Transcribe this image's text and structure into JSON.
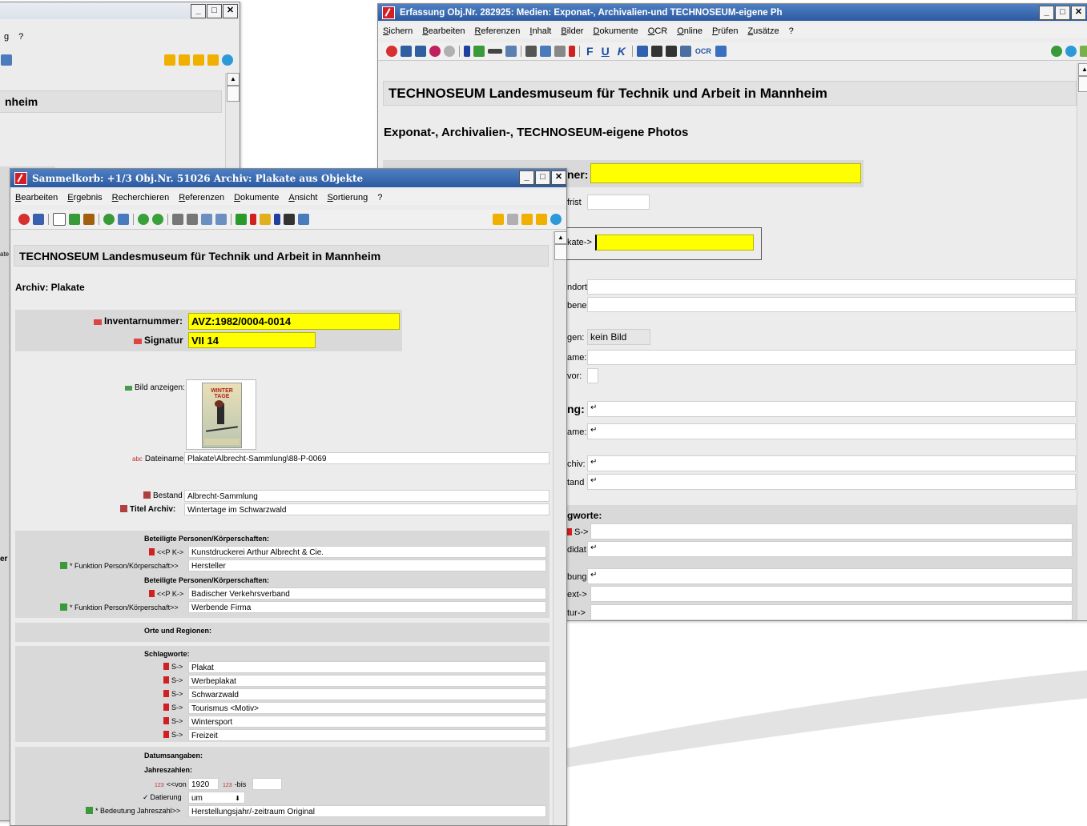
{
  "win_left": {
    "menu": [
      "g",
      "?"
    ],
    "title_frag": "nheim"
  },
  "win_right": {
    "title": "Erfassung Obj.Nr. 282925: Medien: Exponat-, Archivalien-und TECHNOSEUM-eigene Ph",
    "menu": [
      "Sichern",
      "Bearbeiten",
      "Referenzen",
      "Inhalt",
      "Bilder",
      "Dokumente",
      "OCR",
      "Online",
      "Prüfen",
      "Zusätze",
      "?"
    ],
    "toolbar_text": [
      "F",
      "U",
      "K",
      "OCR"
    ],
    "heading": "TECHNOSEUM Landesmuseum für Technik und Arbeit in Mannheim",
    "subheading": "Exponat-, Archivalien-, TECHNOSEUM-eigene Photos",
    "labels": {
      "ner": "ner:",
      "frist": "frist",
      "kate": "kate->",
      "ndort": "ndort",
      "bene": "bene",
      "gen": "gen:",
      "ame": "ame:",
      "vor": "vor:",
      "ng": "ng:",
      "ame2": "ame:",
      "chiv": "chiv:",
      "tand": "tand",
      "gworte": "gworte:",
      "s": "S->",
      "didat": "didat:",
      "bung": "bung:",
      "ext": "ext->",
      "tur": "tur->"
    },
    "bild_value": "kein Bild",
    "return_mark": "↵"
  },
  "win_front": {
    "title": "Sammelkorb: +1/3  Obj.Nr. 51026  Archiv: Plakate aus Objekte",
    "menu": [
      "Bearbeiten",
      "Ergebnis",
      "Recherchieren",
      "Referenzen",
      "Dokumente",
      "Ansicht",
      "Sortierung",
      "?"
    ],
    "heading": "TECHNOSEUM Landesmuseum für Technik und Arbeit in Mannheim",
    "subheading": "Archiv: Plakate",
    "inventar_label": "Inventarnummer:",
    "inventar_value": "AVZ:1982/0004-0014",
    "signatur_label": "Signatur",
    "signatur_value": "VII 14",
    "bild_label": "Bild anzeigen:",
    "poster_text": [
      "WINTER",
      "TAGE"
    ],
    "dateiname_label": "Dateiname:",
    "dateiname_value": "Plakate\\Albrecht-Sammlung\\88-P-0069",
    "bestand_label": "Bestand",
    "bestand_value": "Albrecht-Sammlung",
    "titel_label": "Titel Archiv:",
    "titel_value": "Wintertage im Schwarzwald",
    "beteiligte_heading": "Beteiligte Personen/Körperschaften:",
    "pk_label": "<<P K->",
    "funktion_label": "* Funktion Person/Körperschaft>>",
    "persons": [
      {
        "name": "Kunstdruckerei Arthur Albrecht & Cie.",
        "funktion": "Hersteller"
      },
      {
        "name": "Badischer Verkehrsverband",
        "funktion": "Werbende Firma"
      }
    ],
    "orte_heading": "Orte und Regionen:",
    "schlag_heading": "Schlagworte:",
    "s_label": "S->",
    "schlagworte": [
      "Plakat",
      "Werbeplakat",
      "Schwarzwald",
      "Tourismus <Motiv>",
      "Wintersport",
      "Freizeit"
    ],
    "datum_heading": "Datumsangaben:",
    "jahres_heading": "Jahreszahlen:",
    "von_label": "<<von",
    "von_value": "1920",
    "bis_label": "-bis",
    "bis_value": "",
    "datierung_label": "Datierung",
    "datierung_value": "um",
    "bedeutung_label": "* Bedeutung Jahreszahl>>",
    "bedeutung_value": "Herstellungsjahr/-zeitraum Original",
    "abc": "abc",
    "num": "123"
  },
  "left_edge_fragments": [
    "ate",
    "er"
  ]
}
